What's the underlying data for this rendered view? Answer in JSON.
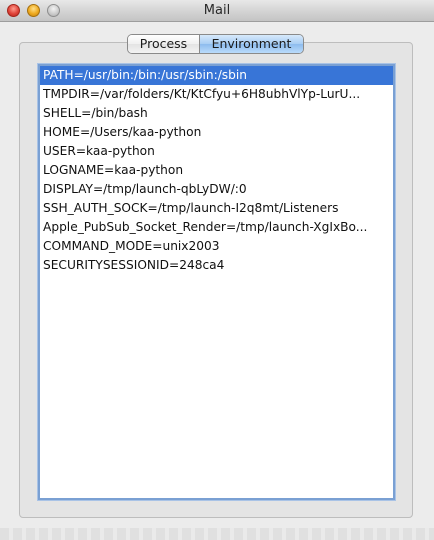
{
  "window": {
    "title": "Mail"
  },
  "tabs": [
    {
      "label": "Process",
      "selected": false
    },
    {
      "label": "Environment",
      "selected": true
    }
  ],
  "env_list": {
    "selected_index": 0,
    "items": [
      "PATH=/usr/bin:/bin:/usr/sbin:/sbin",
      "TMPDIR=/var/folders/Kt/KtCfyu+6H8ubhVlYp-LurU...",
      "SHELL=/bin/bash",
      "HOME=/Users/kaa-python",
      "USER=kaa-python",
      "LOGNAME=kaa-python",
      "DISPLAY=/tmp/launch-qbLyDW/:0",
      "SSH_AUTH_SOCK=/tmp/launch-I2q8mt/Listeners",
      "Apple_PubSub_Socket_Render=/tmp/launch-XgIxBo...",
      "COMMAND_MODE=unix2003",
      "SECURITYSESSIONID=248ca4"
    ]
  },
  "colors": {
    "selection": "#3875d7",
    "selected_tab": "#a8cdf4"
  }
}
